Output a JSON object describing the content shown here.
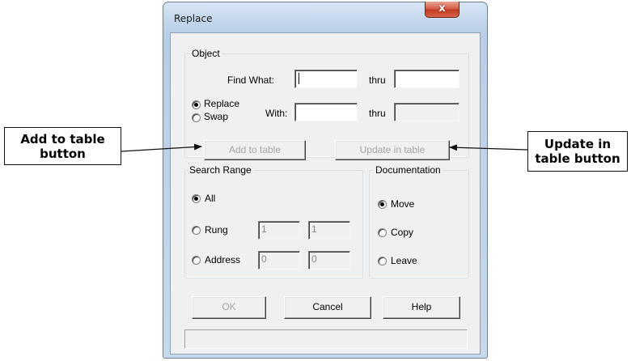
{
  "window": {
    "title": "Replace",
    "close_glyph": "x"
  },
  "object_group": {
    "legend": "Object",
    "find_what_label": "Find What:",
    "find_what_value": "",
    "thru_label_1": "thru",
    "thru_value_1": "",
    "replace_label": "Replace",
    "swap_label": "Swap",
    "with_label": "With:",
    "with_value": "",
    "thru_label_2": "thru",
    "thru_value_2": "",
    "add_to_table": "Add to table",
    "update_in_table": "Update in table"
  },
  "search_range": {
    "legend": "Search Range",
    "all_label": "All",
    "rung_label": "Rung",
    "rung_from": "1",
    "rung_to": "1",
    "address_label": "Address",
    "address_from": "0",
    "address_to": "0"
  },
  "documentation": {
    "legend": "Documentation",
    "move_label": "Move",
    "copy_label": "Copy",
    "leave_label": "Leave"
  },
  "buttons": {
    "ok": "OK",
    "cancel": "Cancel",
    "help": "Help"
  },
  "status_bar": {
    "text": ""
  },
  "callouts": {
    "left": "Add to table\nbutton",
    "right": "Update in\ntable button"
  },
  "colors": {
    "callout_border": "#111111",
    "disabled_text": "#a6a6a6",
    "close_button_red": "#c23c22"
  }
}
